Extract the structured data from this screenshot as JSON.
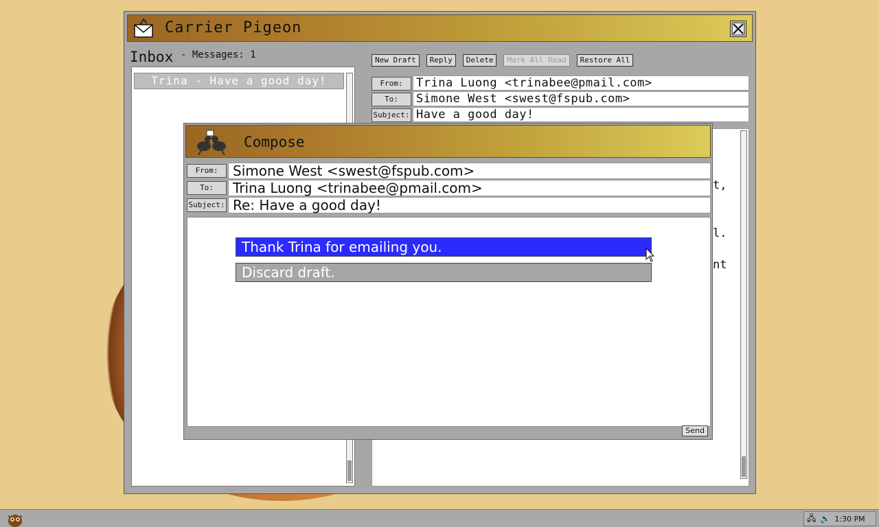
{
  "main_window": {
    "title": "Carrier Pigeon",
    "close_label": "X",
    "inbox_label": "Inbox",
    "message_count": "- Messages: 1",
    "messages": [
      {
        "label": "Trina - Have a good day!"
      }
    ],
    "toolbar": {
      "new_draft": "New Draft",
      "reply": "Reply",
      "delete": "Delete",
      "mark_all_read": "Mark All Read",
      "restore_all": "Restore All"
    },
    "header": {
      "from_label": "From:",
      "from_value": "Trina Luong <trinabee@pmail.com>",
      "to_label": "To:",
      "to_value": "Simone West <swest@fspub.com>",
      "subject_label": "Subject:",
      "subject_value": "Have a good day!"
    },
    "body_fragments": [
      "t,",
      "l.",
      "nt"
    ]
  },
  "compose": {
    "title": "Compose",
    "from_label": "From:",
    "from_value": "Simone West <swest@fspub.com>",
    "to_label": "To:",
    "to_value": "Trina Luong <trinabee@pmail.com>",
    "subject_label": "Subject:",
    "subject_value": "Re: Have a good day!",
    "options": [
      {
        "label": "Thank Trina for emailing you.",
        "selected": true
      },
      {
        "label": "Discard draft.",
        "selected": false
      }
    ],
    "send_label": "Send"
  },
  "taskbar": {
    "clock": "1:30 PM",
    "icons": [
      "network-icon",
      "volume-icon"
    ]
  },
  "colors": {
    "desktop": "#e9cc8c",
    "titlebar_start": "#9a6724",
    "titlebar_end": "#dccb5a",
    "selection": "#2b2bff"
  }
}
